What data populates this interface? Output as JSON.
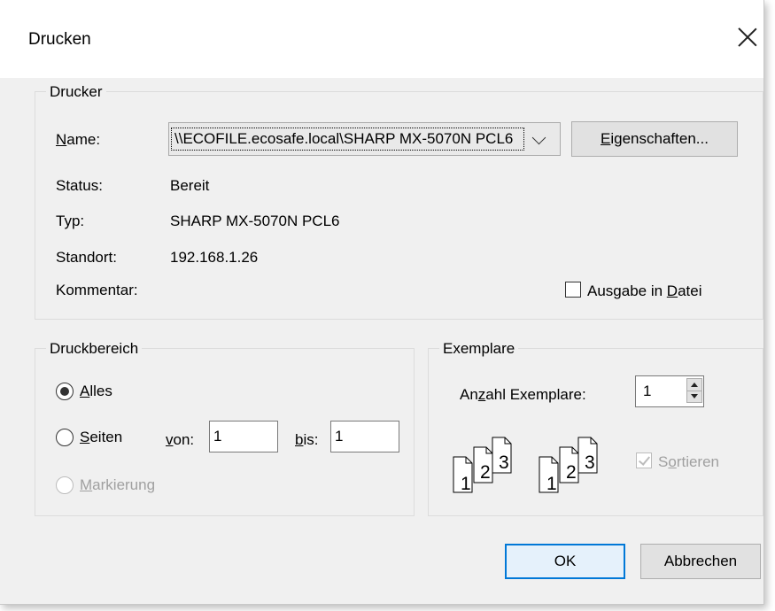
{
  "dialog": {
    "title": "Drucken"
  },
  "printer": {
    "group_label": "Drucker",
    "name_label": "Name:",
    "name_value": "\\\\ECOFILE.ecosafe.local\\SHARP MX-5070N PCL6",
    "properties_button": "Eigenschaften...",
    "status_label": "Status:",
    "status_value": "Bereit",
    "type_label": "Typ:",
    "type_value": "SHARP MX-5070N PCL6",
    "location_label": "Standort:",
    "location_value": "192.168.1.26",
    "comment_label": "Kommentar:",
    "print_to_file_label": "Ausgabe in Datei",
    "print_to_file_checked": false
  },
  "print_range": {
    "group_label": "Druckbereich",
    "all_label": "Alles",
    "pages_label": "Seiten",
    "from_label": "von:",
    "from_value": "1",
    "to_label": "bis:",
    "to_value": "1",
    "selection_label": "Markierung",
    "selected": "Alles"
  },
  "copies": {
    "group_label": "Exemplare",
    "count_label": "Anzahl Exemplare:",
    "count_value": "1",
    "collate_label": "Sortieren",
    "collate_checked": true,
    "collate_enabled": false,
    "collate_icon_pages": [
      "1",
      "2",
      "3"
    ]
  },
  "buttons": {
    "ok": "OK",
    "cancel": "Abbrechen"
  },
  "colors": {
    "accent": "#0078d7",
    "dialog_bg": "#f0f0f0",
    "disabled_text": "#a0a0a0"
  }
}
